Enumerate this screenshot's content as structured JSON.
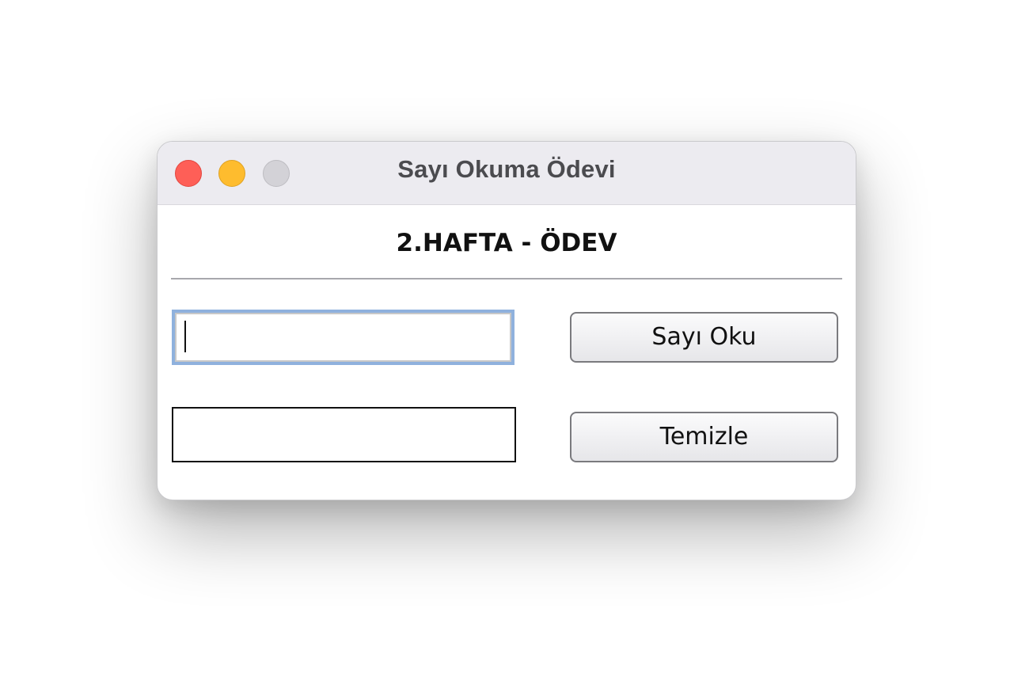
{
  "window": {
    "title": "Sayı Okuma Ödevi"
  },
  "content": {
    "heading": "2.HAFTA - ÖDEV",
    "input_value": "",
    "output_value": "",
    "read_button_label": "Sayı Oku",
    "clear_button_label": "Temizle"
  },
  "colors": {
    "close": "#fe5f57",
    "minimize": "#febc2e",
    "zoom": "#d3d2d7",
    "focus_ring": "#8fb1dd"
  },
  "icons": {
    "close": "close-icon",
    "minimize": "minimize-icon",
    "zoom": "zoom-icon"
  }
}
